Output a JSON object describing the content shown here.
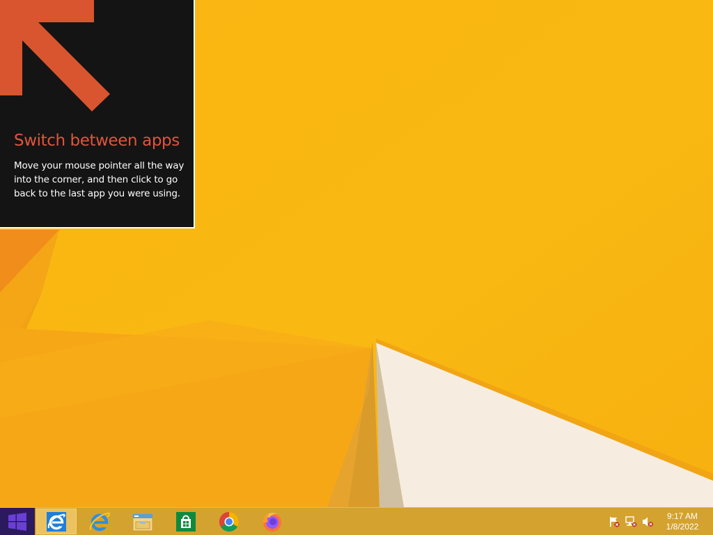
{
  "tip": {
    "title": "Switch between apps",
    "body": "Move your mouse pointer all the way into the corner, and then click to go back to the last app you were using."
  },
  "taskbar": {
    "start_icon": "windows-logo-icon",
    "pinned": [
      {
        "name": "internet-explorer-active",
        "icon": "internet-explorer-icon",
        "active": true
      },
      {
        "name": "internet-explorer",
        "icon": "internet-explorer-icon",
        "active": false
      },
      {
        "name": "file-explorer",
        "icon": "folder-icon",
        "active": false
      },
      {
        "name": "store",
        "icon": "store-icon",
        "active": false
      },
      {
        "name": "chrome",
        "icon": "chrome-icon",
        "active": false
      },
      {
        "name": "firefox",
        "icon": "firefox-icon",
        "active": false
      }
    ],
    "tray_icons": [
      "action-center-flag-icon",
      "network-icon",
      "volume-muted-icon"
    ],
    "clock": {
      "time": "9:17 AM",
      "date": "1/8/2022"
    }
  },
  "colors": {
    "wallpaper": "#f8b611",
    "tip_background": "#141414",
    "tip_title": "#e0553a",
    "arrow": "#d9552f",
    "start_button": "#2b1a5e"
  }
}
